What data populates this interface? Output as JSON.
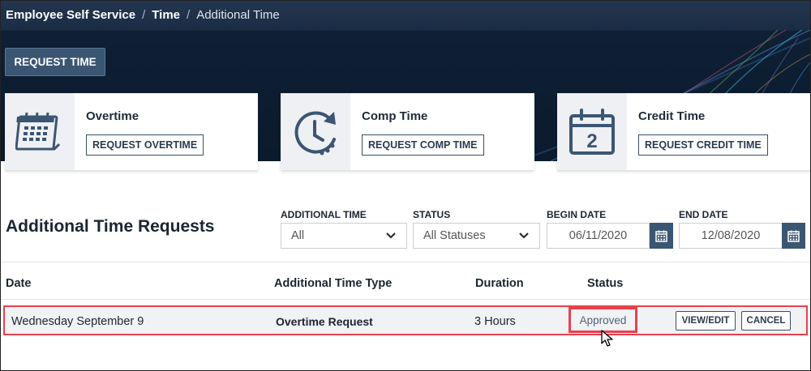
{
  "breadcrumb": {
    "root": "Employee Self Service",
    "section": "Time",
    "current": "Additional Time"
  },
  "header": {
    "request_time_label": "REQUEST TIME"
  },
  "cards": [
    {
      "title": "Overtime",
      "button": "REQUEST OVERTIME",
      "icon": "calendar-grid-icon"
    },
    {
      "title": "Comp Time",
      "button": "REQUEST COMP TIME",
      "icon": "clock-arrow-icon"
    },
    {
      "title": "Credit Time",
      "button": "REQUEST CREDIT TIME",
      "icon": "calendar-day-icon"
    }
  ],
  "requests": {
    "title": "Additional Time Requests",
    "filters": {
      "additional_time_label": "ADDITIONAL TIME",
      "additional_time_value": "All",
      "status_label": "STATUS",
      "status_value": "All Statuses",
      "begin_label": "BEGIN DATE",
      "begin_value": "06/11/2020",
      "end_label": "END DATE",
      "end_value": "12/08/2020"
    },
    "columns": {
      "date": "Date",
      "type": "Additional Time Type",
      "duration": "Duration",
      "status": "Status"
    },
    "rows": [
      {
        "date": "Wednesday September 9",
        "type": "Overtime Request",
        "duration": "3 Hours",
        "status": "Approved",
        "view": "VIEW/EDIT",
        "cancel": "CANCEL"
      }
    ]
  },
  "calendar_day_number": "2",
  "colors": {
    "accent": "#3b5673",
    "highlight": "#e8414e",
    "header_bg": "#0b1a2d"
  }
}
